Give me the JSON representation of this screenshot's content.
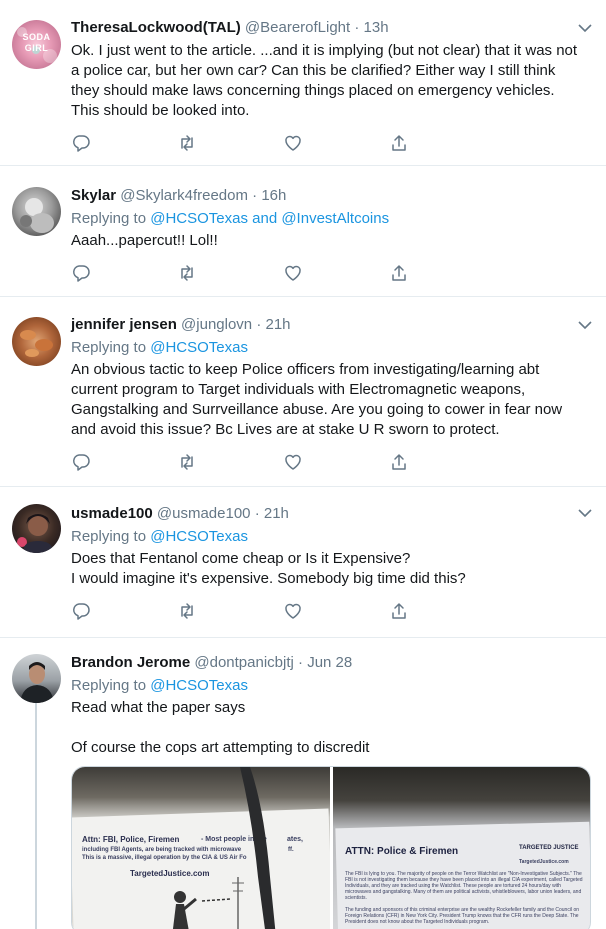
{
  "tweets": [
    {
      "name": "TheresaLockwood(TAL)",
      "handle": "@BearerofLight",
      "time": "13h",
      "replying_prefix": "",
      "replying_to": "",
      "text": "Ok. I just went to the article. ...and it is implying (but not clear) that it was not a police car, but her own car? Can this be clarified? Either way I still think they should make laws concerning things placed on emergency vehicles. This should be looked into.",
      "avatar_label": "SODA GIRL"
    },
    {
      "name": "Skylar",
      "handle": "@Skylark4freedom",
      "time": "16h",
      "replying_prefix": "Replying to",
      "replying_to": "@HCSOTexas and @InvestAltcoins",
      "text": "Aaah...papercut!! Lol!!"
    },
    {
      "name": "jennifer jensen",
      "handle": "@junglovn",
      "time": "21h",
      "replying_prefix": "Replying to",
      "replying_to": "@HCSOTexas",
      "text": "An obvious tactic to keep Police officers from investigating/learning abt current program to Target individuals with Electromagnetic weapons, Gangstalking and Surrveillance abuse. Are you going to cower in fear now and avoid this issue? Bc Lives are at stake U R sworn to protect."
    },
    {
      "name": "usmade100",
      "handle": "@usmade100",
      "time": "21h",
      "replying_prefix": "Replying to",
      "replying_to": "@HCSOTexas",
      "text": "Does that Fentanol come cheap or Is it Expensive?\nI would imagine it's expensive. Somebody big time did this?"
    },
    {
      "name": "Brandon Jerome",
      "handle": "@dontpanicbjtj",
      "time": "Jun 28",
      "replying_prefix": "Replying to",
      "replying_to": "@HCSOTexas",
      "text": "Read what the paper says\n\nOf course the cops art attempting to discredit"
    }
  ],
  "separator": "·",
  "media": {
    "photo1": {
      "heading": "Attn: FBI, Police, Firemen",
      "line1": "- Most people in the",
      "line1b": "ates,",
      "line2": "including FBI Agents, are being tracked with microwave",
      "line2b": "ff.",
      "line3": "This is a massive, illegal operation by the CIA & US Air Fo",
      "site": "TargetedJustice.com"
    },
    "photo2": {
      "heading": "ATTN: Police & Firemen",
      "logo": "TARGETED JUSTICE",
      "site": "TargetedJustice.com",
      "para1": "The FBI is lying to you.  The majority of people on the Terror Watchlist are \"Non-Investigative Subjects.\"  The FBI is not investigating them because they have been placed into an illegal CIA experiment, called Targeted Individuals, and they are tracked using the Watchlist.  These people are tortured 24 hours/day with microwaves and gangstalking.  Many of them are political activists, whistleblowers, labor union leaders, and scientists.",
      "para2": "The funding and sponsors of this criminal enterprise are the wealthy Rockefeller family and the Council on Foreign Relations (CFR) in New York City.  President Trump knows that the CFR runs the Deep State.  The President does not know about the Targeted Individuals program."
    }
  },
  "colors": {
    "accent": "#1b95e0",
    "secondary_text": "#657786",
    "icon": "#657786",
    "border": "#e6ecf0"
  },
  "icons": [
    "chevron-down-icon",
    "reply-icon",
    "retweet-icon",
    "like-icon",
    "share-icon"
  ]
}
